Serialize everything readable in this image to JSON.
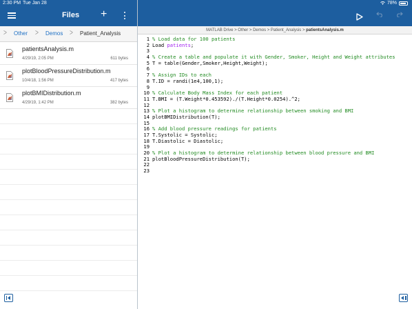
{
  "status_bar": {
    "time": "2:30 PM",
    "date": "Tue Jan 28",
    "battery": "78%"
  },
  "files_panel": {
    "title": "Files",
    "breadcrumb": [
      "Other",
      "Demos",
      "Patient_Analysis"
    ],
    "files": [
      {
        "name": "patientsAnalysis.m",
        "date": "4/29/19, 2:05 PM",
        "size": "611 bytes"
      },
      {
        "name": "plotBloodPressureDistribution.m",
        "date": "10/4/18, 1:56 PM",
        "size": "417 bytes"
      },
      {
        "name": "plotBMIDistribution.m",
        "date": "4/29/19, 1:42 PM",
        "size": "382 bytes"
      }
    ]
  },
  "editor": {
    "path": "MATLAB Drive > Other > Demos > Patient_Analysis > ",
    "file": "patientsAnalysis.m",
    "lines": [
      {
        "n": "1",
        "t": "% Load data for 100 patients",
        "k": "comment"
      },
      {
        "n": "2",
        "t": "Load patients;",
        "k": "load"
      },
      {
        "n": "3",
        "t": "",
        "k": "code"
      },
      {
        "n": "4",
        "t": "% Create a table and populate it with Gender, Smoker, Height and Weight attributes",
        "k": "comment"
      },
      {
        "n": "5",
        "t": "T = table(Gender,Smoker,Height,Weight);",
        "k": "code"
      },
      {
        "n": "6",
        "t": "",
        "k": "code"
      },
      {
        "n": "7",
        "t": "% Assign IDs to each",
        "k": "comment"
      },
      {
        "n": "8",
        "t": "T.ID = randi(1e4,100,1);",
        "k": "code"
      },
      {
        "n": "9",
        "t": "",
        "k": "code"
      },
      {
        "n": "10",
        "t": "% Calculate Body Mass Index for each patient",
        "k": "comment"
      },
      {
        "n": "11",
        "t": "T.BMI = (T.Weight*0.453592)./(T.Height*0.0254).^2;",
        "k": "code"
      },
      {
        "n": "12",
        "t": "",
        "k": "code"
      },
      {
        "n": "13",
        "t": "% Plot a histogram to determine relationship between smoking and BMI",
        "k": "comment"
      },
      {
        "n": "14",
        "t": "plotBMIDistribution(T);",
        "k": "code"
      },
      {
        "n": "15",
        "t": "",
        "k": "code"
      },
      {
        "n": "16",
        "t": "% Add blood pressure readings for patients",
        "k": "comment"
      },
      {
        "n": "17",
        "t": "T.Systolic = Systolic;",
        "k": "code"
      },
      {
        "n": "18",
        "t": "T.Diastolic = Diastolic;",
        "k": "code"
      },
      {
        "n": "19",
        "t": "",
        "k": "code"
      },
      {
        "n": "20",
        "t": "% Plot a histogram to determine relationship between blood pressure and BMI",
        "k": "comment"
      },
      {
        "n": "21",
        "t": "plotBloodPressureDistribution(T);",
        "k": "code"
      },
      {
        "n": "22",
        "t": "",
        "k": "code"
      },
      {
        "n": "23",
        "t": "",
        "k": "code"
      }
    ],
    "load_keyword": "Load ",
    "load_string": "patients",
    "load_end": ";"
  },
  "colors": {
    "header": "#1d5e9f",
    "comment": "#228b22",
    "string": "#a020f0"
  }
}
